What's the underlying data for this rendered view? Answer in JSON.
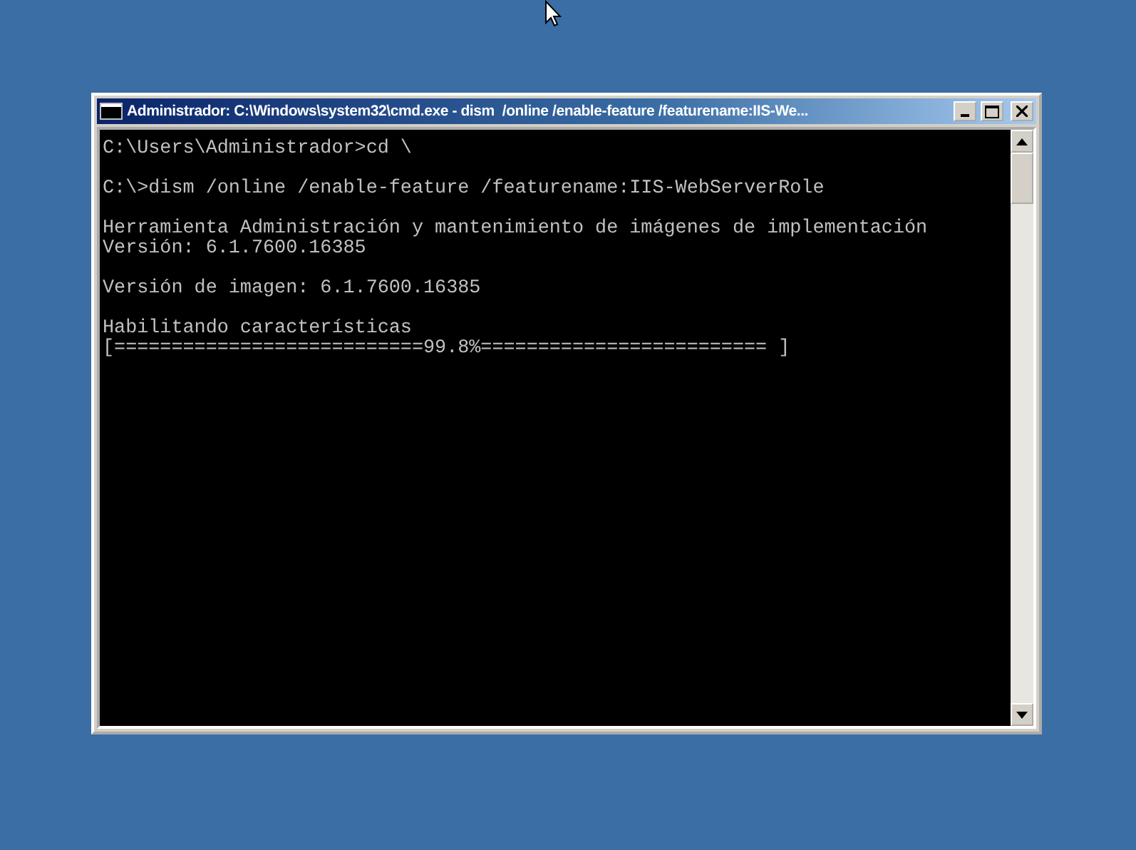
{
  "window": {
    "title": "Administrador: C:\\Windows\\system32\\cmd.exe - dism  /online /enable-feature /featurename:IIS-We..."
  },
  "console": {
    "paragraphs": [
      [
        "C:\\Users\\Administrador>cd \\"
      ],
      [
        "C:\\>dism /online /enable-feature /featurename:IIS-WebServerRole"
      ],
      [
        "Herramienta Administración y mantenimiento de imágenes de implementación",
        "Versión: 6.1.7600.16385"
      ],
      [
        "Versión de imagen: 6.1.7600.16385"
      ],
      [
        "Habilitando características",
        "[===========================99.8%========================= ]"
      ]
    ]
  }
}
